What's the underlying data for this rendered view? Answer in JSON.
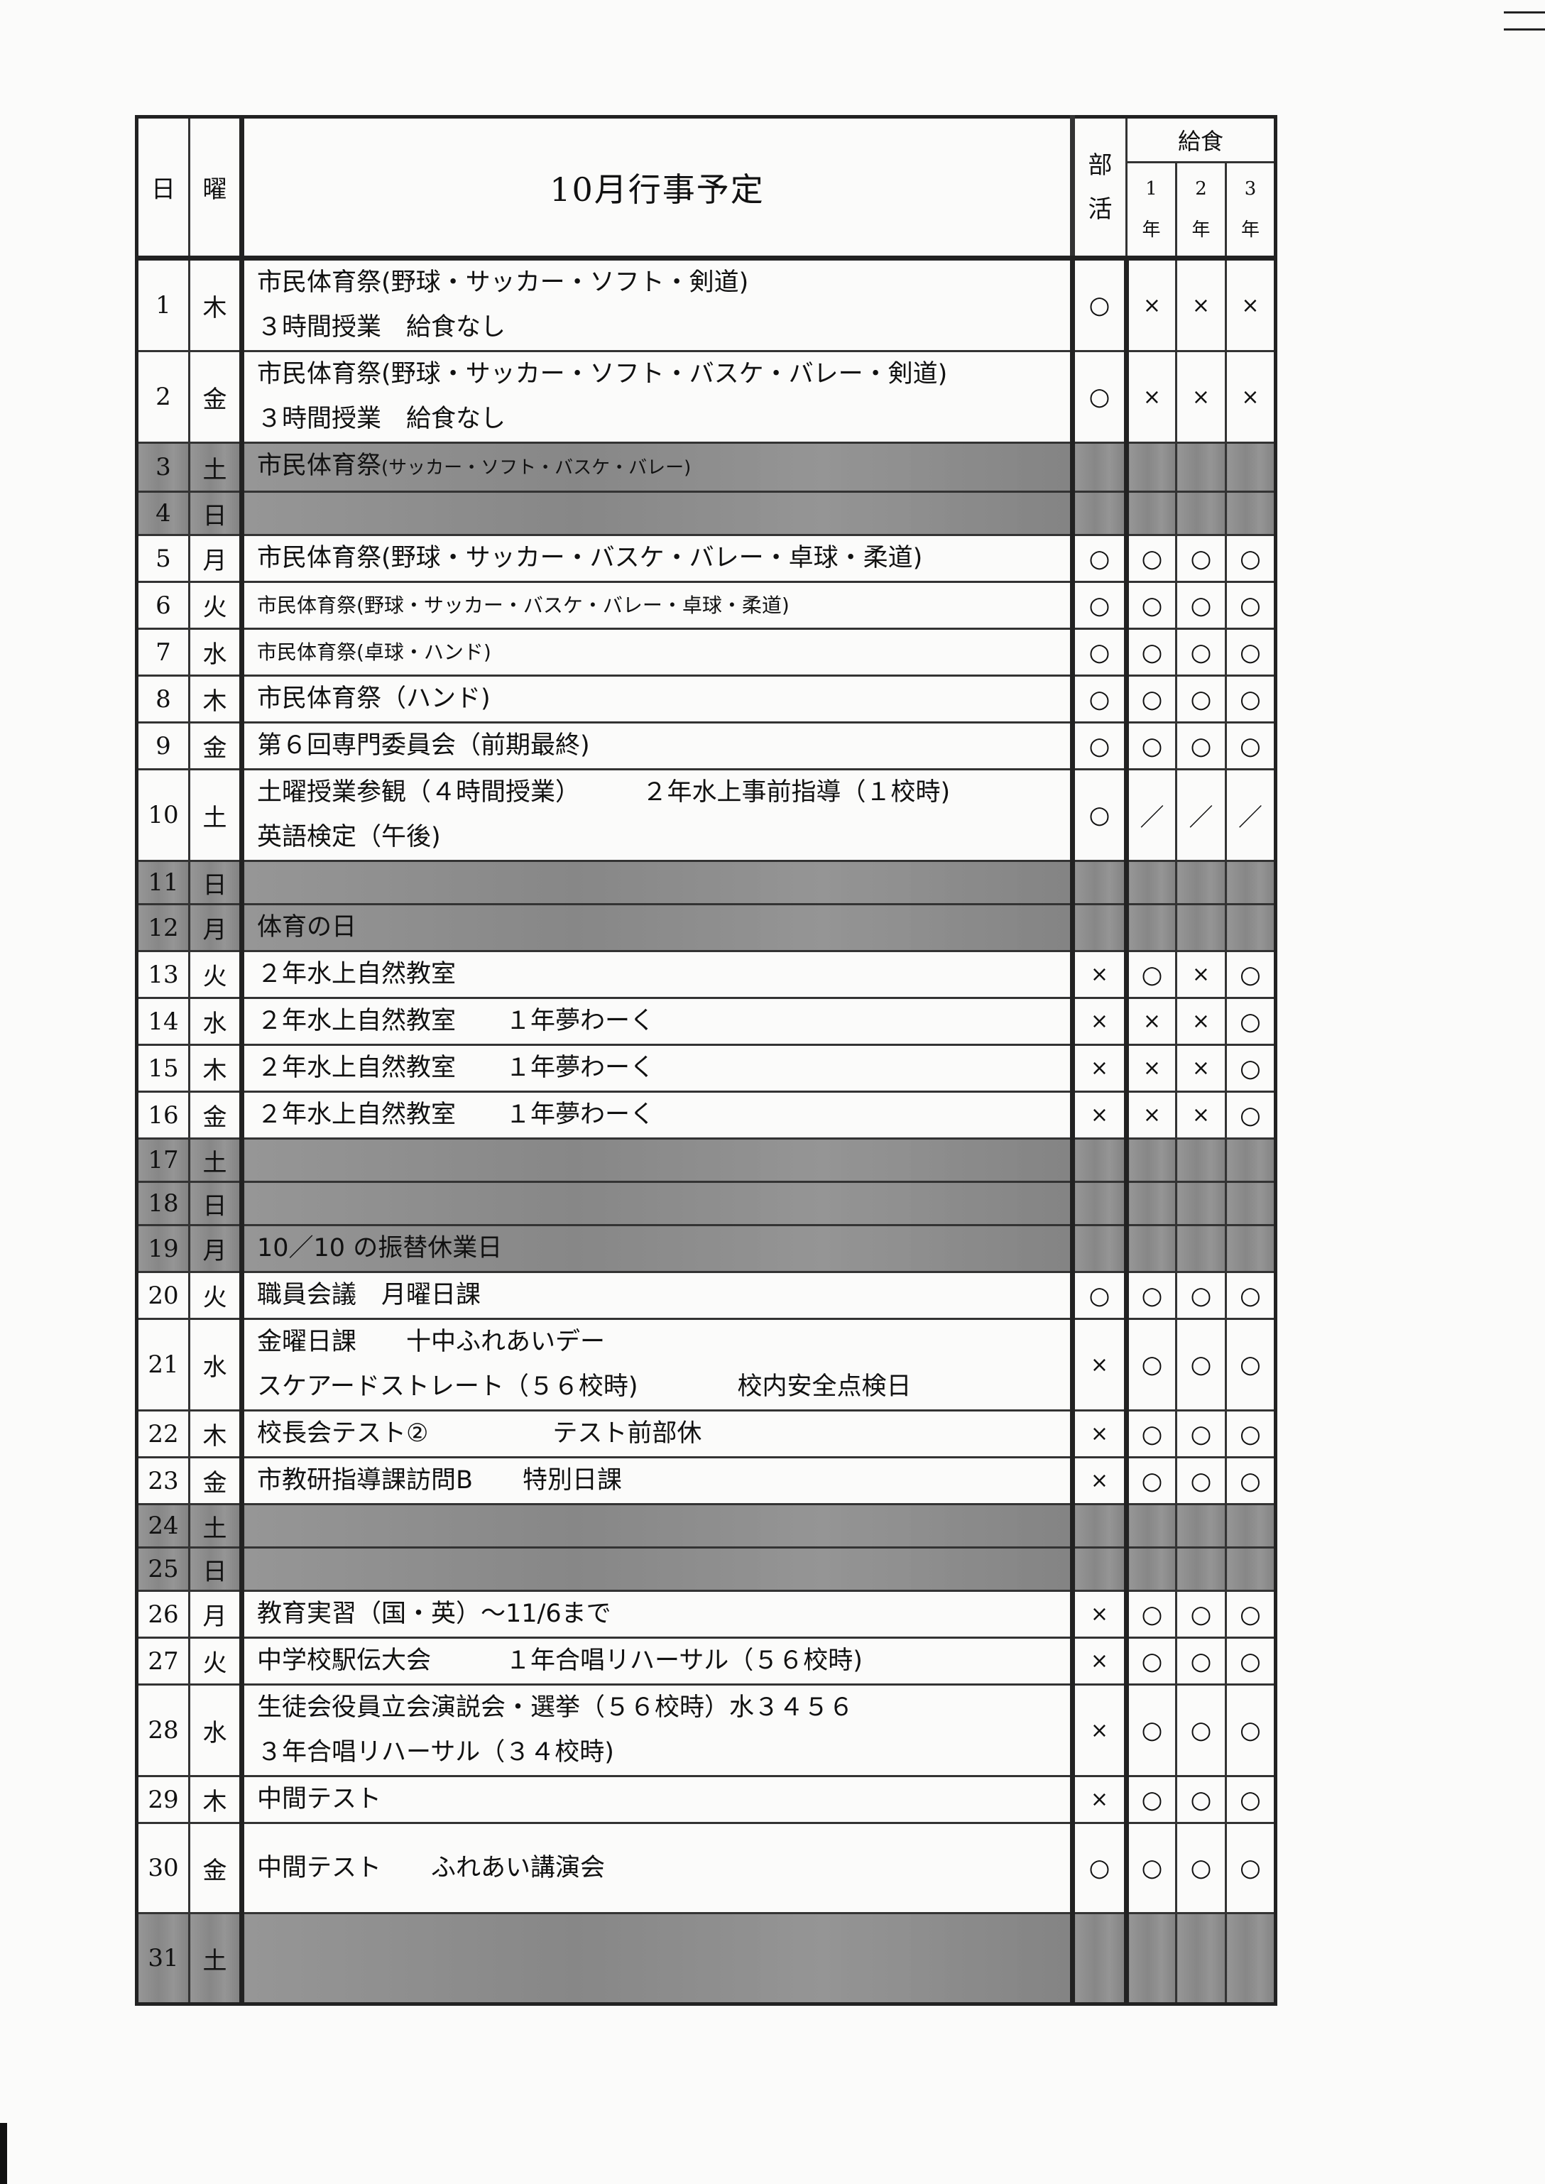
{
  "header": {
    "day": "日",
    "weekday": "曜",
    "title": "10月行事予定",
    "club_line1": "部",
    "club_line2": "活",
    "lunch": "給食",
    "grades": [
      {
        "num": "1",
        "unit": "年"
      },
      {
        "num": "2",
        "unit": "年"
      },
      {
        "num": "3",
        "unit": "年"
      }
    ]
  },
  "rows": [
    {
      "day": "1",
      "dow": "木",
      "shade": false,
      "tall": true,
      "lines": [
        "市民体育祭(野球・サッカー・ソフト・剣道)",
        "３時間授業　給食なし"
      ],
      "club": "○",
      "g1": "×",
      "g2": "×",
      "g3": "×"
    },
    {
      "day": "2",
      "dow": "金",
      "shade": false,
      "tall": true,
      "lines": [
        "市民体育祭(野球・サッカー・ソフト・バスケ・バレー・剣道)",
        "３時間授業　給食なし"
      ],
      "club": "○",
      "g1": "×",
      "g2": "×",
      "g3": "×"
    },
    {
      "day": "3",
      "dow": "土",
      "shade": true,
      "tall": false,
      "lines": [
        "市民体育祭"
      ],
      "lines_small": "(サッカー・ソフト・バスケ・バレー)",
      "club": "",
      "g1": "",
      "g2": "",
      "g3": ""
    },
    {
      "day": "4",
      "dow": "日",
      "shade": true,
      "tall": false,
      "lines": [
        ""
      ],
      "club": "",
      "g1": "",
      "g2": "",
      "g3": ""
    },
    {
      "day": "5",
      "dow": "月",
      "shade": false,
      "tall": false,
      "lines": [
        "市民体育祭(野球・サッカー・バスケ・バレー・卓球・柔道)"
      ],
      "club": "○",
      "g1": "○",
      "g2": "○",
      "g3": "○"
    },
    {
      "day": "6",
      "dow": "火",
      "shade": false,
      "tall": false,
      "small": true,
      "lines": [
        "市民体育祭(野球・サッカー・バスケ・バレー・卓球・柔道)"
      ],
      "club": "○",
      "g1": "○",
      "g2": "○",
      "g3": "○"
    },
    {
      "day": "7",
      "dow": "水",
      "shade": false,
      "tall": false,
      "small": true,
      "lines": [
        "市民体育祭(卓球・ハンド)"
      ],
      "club": "○",
      "g1": "○",
      "g2": "○",
      "g3": "○"
    },
    {
      "day": "8",
      "dow": "木",
      "shade": false,
      "tall": false,
      "lines": [
        "市民体育祭（ハンド)"
      ],
      "club": "○",
      "g1": "○",
      "g2": "○",
      "g3": "○"
    },
    {
      "day": "9",
      "dow": "金",
      "shade": false,
      "tall": false,
      "lines": [
        "第６回専門委員会（前期最終)"
      ],
      "club": "○",
      "g1": "○",
      "g2": "○",
      "g3": "○"
    },
    {
      "day": "10",
      "dow": "土",
      "shade": false,
      "tall": true,
      "lines": [
        "土曜授業参観（４時間授業）　　　２年水上事前指導（１校時)",
        "英語検定（午後)"
      ],
      "club": "○",
      "g1": "／",
      "g2": "／",
      "g3": "／"
    },
    {
      "day": "11",
      "dow": "日",
      "shade": true,
      "tall": false,
      "lines": [
        ""
      ],
      "club": "",
      "g1": "",
      "g2": "",
      "g3": ""
    },
    {
      "day": "12",
      "dow": "月",
      "shade": true,
      "tall": false,
      "lines": [
        "体育の日"
      ],
      "club": "",
      "g1": "",
      "g2": "",
      "g3": ""
    },
    {
      "day": "13",
      "dow": "火",
      "shade": false,
      "tall": false,
      "lines": [
        "２年水上自然教室"
      ],
      "club": "×",
      "g1": "○",
      "g2": "×",
      "g3": "○"
    },
    {
      "day": "14",
      "dow": "水",
      "shade": false,
      "tall": false,
      "lines": [
        "２年水上自然教室　　１年夢わーく"
      ],
      "club": "×",
      "g1": "×",
      "g2": "×",
      "g3": "○"
    },
    {
      "day": "15",
      "dow": "木",
      "shade": false,
      "tall": false,
      "lines": [
        "２年水上自然教室　　１年夢わーく"
      ],
      "club": "×",
      "g1": "×",
      "g2": "×",
      "g3": "○"
    },
    {
      "day": "16",
      "dow": "金",
      "shade": false,
      "tall": false,
      "lines": [
        "２年水上自然教室　　１年夢わーく"
      ],
      "club": "×",
      "g1": "×",
      "g2": "×",
      "g3": "○"
    },
    {
      "day": "17",
      "dow": "土",
      "shade": true,
      "tall": false,
      "lines": [
        ""
      ],
      "club": "",
      "g1": "",
      "g2": "",
      "g3": ""
    },
    {
      "day": "18",
      "dow": "日",
      "shade": true,
      "tall": false,
      "lines": [
        ""
      ],
      "club": "",
      "g1": "",
      "g2": "",
      "g3": ""
    },
    {
      "day": "19",
      "dow": "月",
      "shade": true,
      "tall": false,
      "lines": [
        "10／10 の振替休業日"
      ],
      "club": "",
      "g1": "",
      "g2": "",
      "g3": ""
    },
    {
      "day": "20",
      "dow": "火",
      "shade": false,
      "tall": false,
      "lines": [
        "職員会議　月曜日課"
      ],
      "club": "○",
      "g1": "○",
      "g2": "○",
      "g3": "○"
    },
    {
      "day": "21",
      "dow": "水",
      "shade": false,
      "tall": true,
      "lines": [
        "金曜日課　　十中ふれあいデー",
        "スケアードストレート（５６校時)　　　　校内安全点検日"
      ],
      "club": "×",
      "g1": "○",
      "g2": "○",
      "g3": "○"
    },
    {
      "day": "22",
      "dow": "木",
      "shade": false,
      "tall": false,
      "lines": [
        "校長会テスト②　　　　　テスト前部休"
      ],
      "club": "×",
      "g1": "○",
      "g2": "○",
      "g3": "○"
    },
    {
      "day": "23",
      "dow": "金",
      "shade": false,
      "tall": false,
      "lines": [
        "市教研指導課訪問B　　特別日課"
      ],
      "club": "×",
      "g1": "○",
      "g2": "○",
      "g3": "○"
    },
    {
      "day": "24",
      "dow": "土",
      "shade": true,
      "tall": false,
      "lines": [
        ""
      ],
      "club": "",
      "g1": "",
      "g2": "",
      "g3": ""
    },
    {
      "day": "25",
      "dow": "日",
      "shade": true,
      "tall": false,
      "lines": [
        ""
      ],
      "club": "",
      "g1": "",
      "g2": "",
      "g3": ""
    },
    {
      "day": "26",
      "dow": "月",
      "shade": false,
      "tall": false,
      "lines": [
        "教育実習（国・英）～11/6まで"
      ],
      "club": "×",
      "g1": "○",
      "g2": "○",
      "g3": "○"
    },
    {
      "day": "27",
      "dow": "火",
      "shade": false,
      "tall": false,
      "lines": [
        "中学校駅伝大会　　　１年合唱リハーサル（５６校時)"
      ],
      "club": "×",
      "g1": "○",
      "g2": "○",
      "g3": "○"
    },
    {
      "day": "28",
      "dow": "水",
      "shade": false,
      "tall": true,
      "lines": [
        "生徒会役員立会演説会・選挙（５６校時）水３４５６",
        "３年合唱リハーサル（３４校時)"
      ],
      "club": "×",
      "g1": "○",
      "g2": "○",
      "g3": "○"
    },
    {
      "day": "29",
      "dow": "木",
      "shade": false,
      "tall": false,
      "lines": [
        "中間テスト"
      ],
      "club": "×",
      "g1": "○",
      "g2": "○",
      "g3": "○"
    },
    {
      "day": "30",
      "dow": "金",
      "shade": false,
      "tall": true,
      "lines": [
        "中間テスト　　ふれあい講演会"
      ],
      "club": "○",
      "g1": "○",
      "g2": "○",
      "g3": "○"
    },
    {
      "day": "31",
      "dow": "土",
      "shade": true,
      "tall": true,
      "lines": [
        ""
      ],
      "club": "",
      "g1": "",
      "g2": "",
      "g3": ""
    }
  ]
}
